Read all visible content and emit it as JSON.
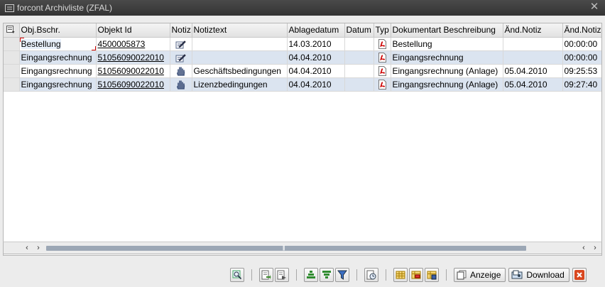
{
  "window": {
    "title": "forcont Archivliste (ZFAL)",
    "title_icon": "list-window-icon",
    "close_icon": "close-icon"
  },
  "table": {
    "columns": [
      "Obj.Bschr.",
      "Objekt Id",
      "Notiz",
      "Notiztext",
      "Ablagedatum",
      "Datum",
      "Typ",
      "Dokumentart Beschreibung",
      "Änd.Notiz",
      "Änd.Notiz"
    ],
    "rows": [
      {
        "obj_bschr": "Bestellung",
        "objekt_id": "4500005873",
        "notiz_icon": "note-edit-icon",
        "notiztext": "",
        "ablagedatum": "14.03.2010",
        "datum": "",
        "typ_icon": "pdf-icon",
        "dokumentart": "Bestellung",
        "aend_notiz_date": "",
        "aend_notiz_time": "00:00:00"
      },
      {
        "obj_bschr": "Eingangsrechnung",
        "objekt_id": "51056090022010",
        "notiz_icon": "note-edit-icon",
        "notiztext": "",
        "ablagedatum": "04.04.2010",
        "datum": "",
        "typ_icon": "pdf-icon",
        "dokumentart": "Eingangsrechnung",
        "aend_notiz_date": "",
        "aend_notiz_time": "00:00:00"
      },
      {
        "obj_bschr": "Eingangsrechnung",
        "objekt_id": "51056090022010",
        "notiz_icon": "note-view-icon",
        "notiztext": "Geschäftsbedingungen",
        "ablagedatum": "04.04.2010",
        "datum": "",
        "typ_icon": "pdf-icon",
        "dokumentart": "Eingangsrechnung (Anlage)",
        "aend_notiz_date": "05.04.2010",
        "aend_notiz_time": "09:25:53"
      },
      {
        "obj_bschr": "Eingangsrechnung",
        "objekt_id": "51056090022010",
        "notiz_icon": "note-view-icon",
        "notiztext": "Lizenzbedingungen",
        "ablagedatum": "04.04.2010",
        "datum": "",
        "typ_icon": "pdf-icon",
        "dokumentart": "Eingangsrechnung (Anlage)",
        "aend_notiz_date": "05.04.2010",
        "aend_notiz_time": "09:27:40"
      }
    ]
  },
  "scrollbar": {
    "left_icon": "chevron-left-icon",
    "right_icon": "chevron-right-icon",
    "grip": "|||"
  },
  "toolbar": {
    "anzeige_label": "Anzeige",
    "download_label": "Download",
    "icons": [
      "find-icon",
      "export-icon",
      "export-alt-icon",
      "sort-ascending-icon",
      "sort-descending-icon",
      "filter-icon",
      "details-icon",
      "layout-icon",
      "layout-select-icon",
      "layout-save-icon",
      "display-icon",
      "download-icon",
      "cancel-icon"
    ]
  },
  "colors": {
    "titlebar": "#3a3a3a",
    "row_alt": "#dbe4f0",
    "accent_red": "#c00000"
  }
}
